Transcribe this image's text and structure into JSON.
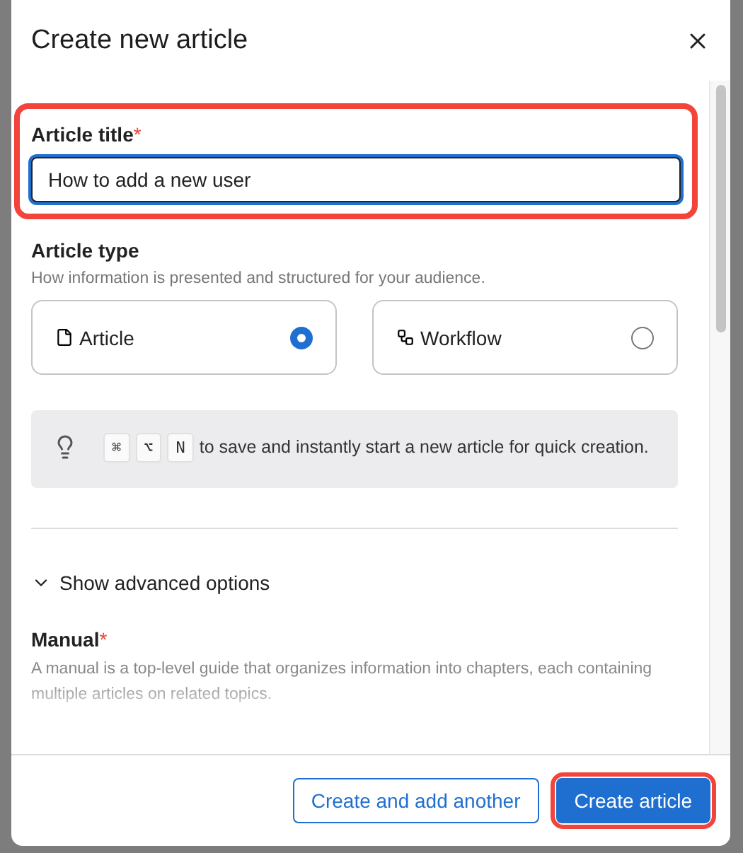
{
  "dialog": {
    "title": "Create new article"
  },
  "title_field": {
    "label": "Article title",
    "required_mark": "*",
    "value": "How to add a new user",
    "focused": true,
    "highlighted": true
  },
  "article_type": {
    "label": "Article type",
    "hint": "How information is presented and structured for your audience.",
    "options": [
      {
        "kind": "article",
        "label": "Article",
        "selected": true
      },
      {
        "kind": "workflow",
        "label": "Workflow",
        "selected": false
      }
    ]
  },
  "tip": {
    "keys": [
      "⌘",
      "⌥",
      "N"
    ],
    "text": "to save and instantly start a new article for quick creation."
  },
  "advanced_toggle": {
    "label": "Show advanced options",
    "expanded": false
  },
  "manual": {
    "label": "Manual",
    "required_mark": "*",
    "description": "A manual is a top-level guide that organizes information into chapters, each containing multiple articles on related topics."
  },
  "footer": {
    "buttons": [
      {
        "kind": "secondary",
        "label": "Create and add another",
        "highlighted": false
      },
      {
        "kind": "primary",
        "label": "Create article",
        "highlighted": true
      }
    ]
  }
}
